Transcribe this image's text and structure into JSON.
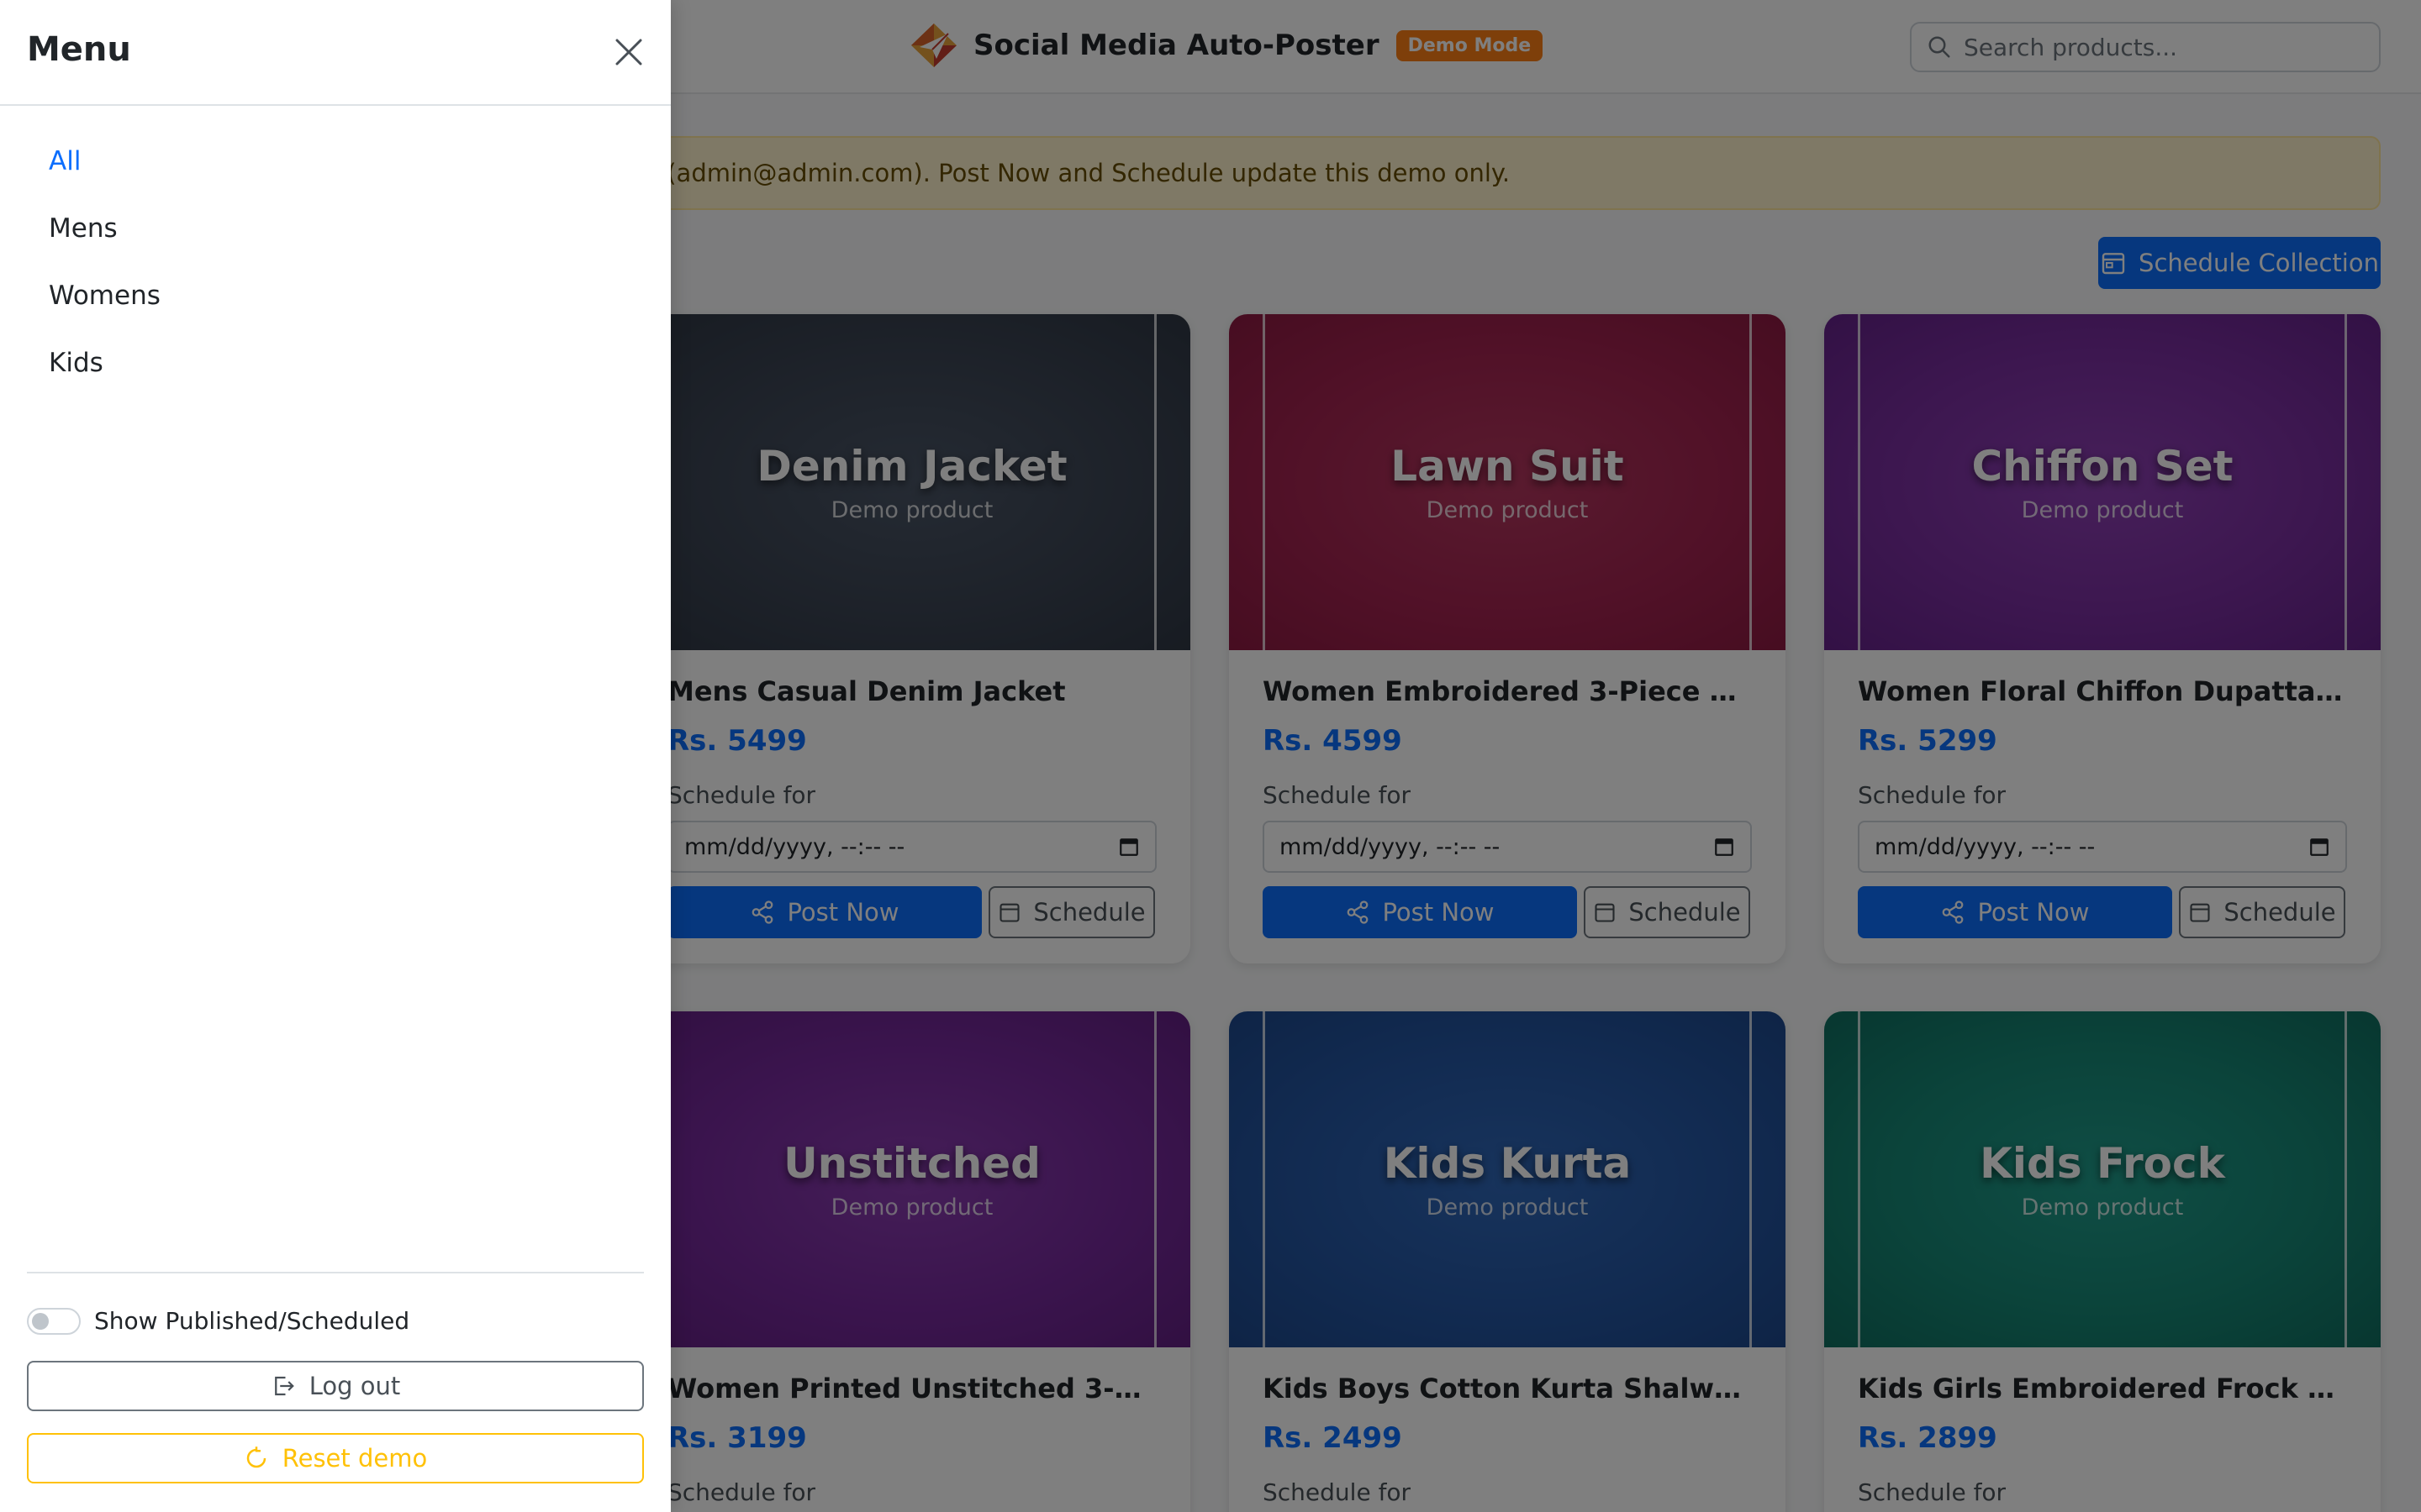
{
  "header": {
    "title": "Social Media Auto-Poster",
    "badge": "Demo Mode",
    "logo_icon": "paper-plane-logo-icon",
    "search_placeholder": "Search products..."
  },
  "alert": {
    "text": "acebook / Instagram posting. Signed in as Admin (admin@admin.com). Post Now and Schedule update this demo only."
  },
  "toolbar": {
    "schedule_collection_label": "Schedule Collection"
  },
  "products": [
    {
      "image_title": "Denim Jacket",
      "image_subtitle": "Demo product",
      "name": "Mens Casual Denim Jacket",
      "price": "Rs. 5499",
      "schedule_label": "Schedule for",
      "date_placeholder": "mm/dd/yyyy, --:-- --",
      "post_label": "Post Now",
      "schedule_button": "Schedule",
      "color": "#3a4352"
    },
    {
      "image_title": "Lawn Suit",
      "image_subtitle": "Demo product",
      "name": "Women Embroidered 3-Piece Lawn ...",
      "price": "Rs. 4599",
      "schedule_label": "Schedule for",
      "date_placeholder": "mm/dd/yyyy, --:-- --",
      "post_label": "Post Now",
      "schedule_button": "Schedule",
      "color": "#a32350"
    },
    {
      "image_title": "Chiffon Set",
      "image_subtitle": "Demo product",
      "name": "Women Floral Chiffon Dupatta Suit ...",
      "price": "Rs. 5299",
      "schedule_label": "Schedule for",
      "date_placeholder": "mm/dd/yyyy, --:-- --",
      "post_label": "Post Now",
      "schedule_button": "Schedule",
      "color": "#7a2ea0"
    },
    {
      "image_title": "Unstitched",
      "image_subtitle": "Demo product",
      "name": "Women Printed Unstitched 3-Piece ...",
      "price": "Rs. 3199",
      "schedule_label": "Schedule for",
      "color": "#76299c"
    },
    {
      "image_title": "Kids Kurta",
      "image_subtitle": "Demo product",
      "name": "Kids Boys Cotton Kurta Shalwar - Bl...",
      "price": "Rs. 2499",
      "schedule_label": "Schedule for",
      "color": "#2456a3"
    },
    {
      "image_title": "Kids Frock",
      "image_subtitle": "Demo product",
      "name": "Kids Girls Embroidered Frock Set",
      "price": "Rs. 2899",
      "schedule_label": "Schedule for",
      "color": "#168775"
    }
  ],
  "menu": {
    "title": "Menu",
    "items": [
      {
        "label": "All",
        "active": true
      },
      {
        "label": "Mens",
        "active": false
      },
      {
        "label": "Womens",
        "active": false
      },
      {
        "label": "Kids",
        "active": false
      }
    ],
    "toggle_label": "Show Published/Scheduled",
    "toggle_on": false,
    "logout_label": "Log out",
    "reset_label": "Reset demo"
  },
  "colors": {
    "primary": "#0d6efd",
    "badge": "#fd7e14",
    "alert_bg": "#fff3cd",
    "reset": "#ffc107"
  }
}
